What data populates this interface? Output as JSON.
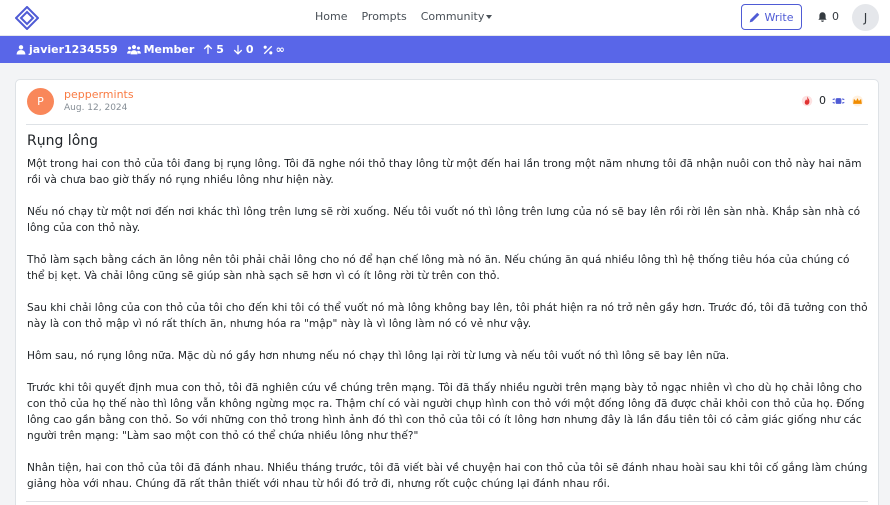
{
  "nav": {
    "links": [
      "Home",
      "Prompts",
      "Community"
    ],
    "write_label": "Write",
    "notif_count": "0",
    "user_initial": "J"
  },
  "userbar": {
    "username": "javier1234559",
    "role": "Member",
    "upvotes": "5",
    "downvotes": "0",
    "ratio": "∞"
  },
  "post": {
    "author_initial": "P",
    "author": "peppermints",
    "date": "Aug. 12, 2024",
    "fire_count": "0",
    "title": "Rụng lông",
    "paragraphs": [
      "Một trong hai con thỏ của tôi đang bị rụng lông. Tôi đã nghe nói thỏ thay lông từ một đến hai lần trong một năm nhưng tôi đã nhận nuôi con thỏ này hai năm rồi và chưa bao giờ thấy nó rụng nhiều lông như hiện này.",
      "Nếu nó chạy từ một nơi đến nơi khác thì lông trên lưng sẽ rời xuống. Nếu tôi vuốt nó thì lông trên lưng của nó sẽ bay lên rồi rời lên sàn nhà. Khắp sàn nhà có lông của con thỏ này.",
      "Thỏ làm sạch bằng cách ăn lông nên tôi phải chải lông cho nó để hạn chế lông mà nó ăn. Nếu chúng ăn quá nhiều lông thì hệ thống tiêu hóa của chúng có thể bị kẹt. Và chải lông cũng sẽ giúp sàn nhà sạch sẽ hơn vì có ít lông rời từ trên con thỏ.",
      "Sau khi chải lông của con thỏ của tôi cho đến khi tôi có thể vuốt nó mà lông không bay lên, tôi phát hiện ra nó trở nên gầy hơn. Trước đó, tôi đã tưởng con thỏ này là con thỏ mập vì nó rất thích ăn, nhưng hóa ra \"mập\" này là vì lông làm nó có vẻ như vậy.",
      "Hôm sau, nó rụng lông nữa. Mặc dù nó gầy hơn nhưng nếu nó chạy thì lông lại rời từ lưng và nếu tôi vuốt nó thì lông sẽ bay lên nữa.",
      "Trước khi tôi quyết định mua con thỏ, tôi đã nghiên cứu về chúng trên mạng. Tôi đã thấy nhiều người trên mạng bày tỏ ngạc nhiên vì cho dù họ chải lông cho con thỏ của họ thế nào thì lông vẫn không ngừng mọc ra. Thậm chí có vài người chụp hình con thỏ với một đống lông đã được chải khỏi con thỏ của họ. Đống lông cao gần bằng con thỏ. So với những con thỏ trong hình ảnh đó thì con thỏ của tôi có ít lông hơn nhưng đây là lần đầu tiên tôi có cảm giác giống như các người trên mạng: \"Làm sao một con thỏ có thể chứa nhiều lông như thế?\"",
      "Nhân tiện, hai con thỏ của tôi đã đánh nhau. Nhiều tháng trước, tôi đã viết bài về chuyện hai con thỏ của tôi sẽ đánh nhau hoài sau khi tôi cố gắng làm chúng giảng hòa với nhau. Chúng đã rất thân thiết với nhau từ hồi đó trở đi, nhưng rốt cuộc chúng lại đánh nhau rồi."
    ]
  },
  "colors": {
    "brand": "#5966e8",
    "author": "#f97b43"
  }
}
